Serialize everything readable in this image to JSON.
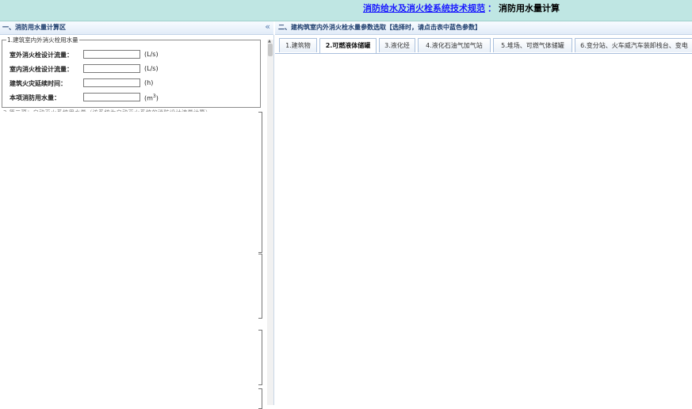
{
  "header": {
    "link_text": "消防给水及消火栓系统技术规范",
    "separator": "：",
    "page_title": "消防用水量计算"
  },
  "left_panel": {
    "title": "一、消防用水量计算区",
    "collapse_icon": "«",
    "group": {
      "legend": "1.建筑室内外消火栓用水量",
      "fields": [
        {
          "label": "室外消火栓设计流量：",
          "value": "",
          "unit": "(L/s)"
        },
        {
          "label": "室内消火栓设计流量：",
          "value": "",
          "unit": "(L/s)"
        },
        {
          "label": "建筑火灾延续时间：",
          "value": "",
          "unit": "(h)"
        },
        {
          "label": "本项消防用水量：",
          "value": "",
          "unit": "(m",
          "unit_sup": "3",
          "unit_tail": ")"
        }
      ]
    },
    "truncated_text": "2.第二项：自动灭火系统用水量（该系统为自动灭火系统的消防设计流量计算）"
  },
  "right_panel": {
    "title": "二、建构筑室内外消火栓水量参数选取【选择时，请点击表中蓝色参数】",
    "tabs": [
      {
        "label": "1.建筑物",
        "active": false
      },
      {
        "label": "2.可燃液体储罐",
        "active": true
      },
      {
        "label": "3.液化烃",
        "active": false
      },
      {
        "label": "4.液化石油气加气站",
        "active": false
      },
      {
        "label": "5.堆场、可燃气体储罐",
        "active": false
      },
      {
        "label": "6.变分站、火车威汽车装卸栈台、变电",
        "active": false
      }
    ]
  }
}
